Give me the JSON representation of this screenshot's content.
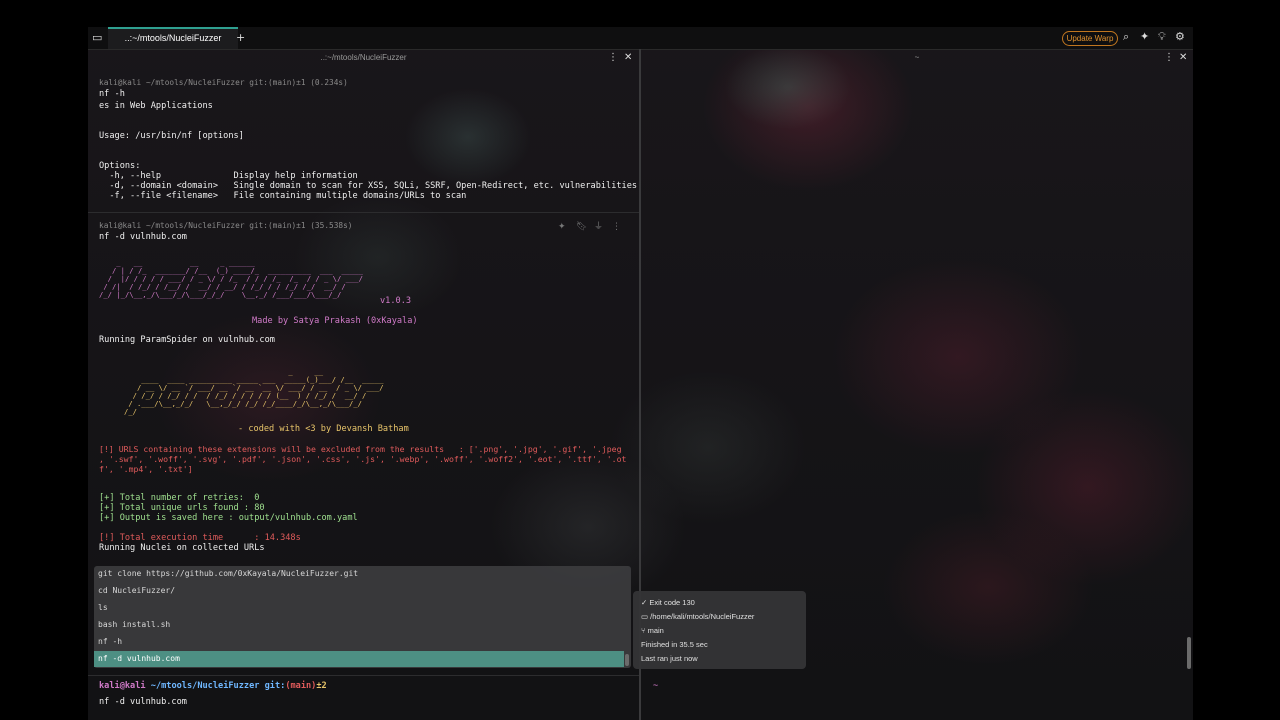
{
  "tabbar": {
    "tab_title": "..:~/mtools/NucleiFuzzer",
    "add_tab": "+",
    "update_button": "Update Warp"
  },
  "panes": {
    "left_title": "..:~/mtools/NucleiFuzzer",
    "right_title": "~"
  },
  "block1": {
    "prompt": "kali@kali ~/mtools/NucleiFuzzer git:(main)±1 (0.234s)",
    "command": "nf -h",
    "lines": [
      "es in Web Applications",
      "",
      "",
      "Usage: /usr/bin/nf [options]",
      "",
      "",
      "Options:",
      "  -h, --help              Display help information",
      "  -d, --domain <domain>   Single domain to scan for XSS, SQLi, SSRF, Open-Redirect, etc. vulnerabilities",
      "  -f, --file <filename>   File containing multiple domains/URLs to scan"
    ]
  },
  "block2": {
    "prompt": "kali@kali ~/mtools/NucleiFuzzer git:(main)±1 (35.538s)",
    "command": "nf -d vulnhub.com",
    "ascii_nf": "    _   __           __     _ ______                         \n   / | / /_  _______/ /__  (_) ____/_  __________  ___  _____\n  /  |/ / / / / ___/ / _ \\/ / /_  / / / /_  /_  / / _ \\/ ___/\n / /|  / /_/ / /__/ /  __/ / __/ / /_/ / / /_/ /_/  __/ /    \n/_/ |_/\\__,_/\\___/_/\\___/_/_/    \\__,_/ /___/___/\\___/_/     ",
    "version": "v1.0.3",
    "made_by": "Made by Satya Prakash (0xKayala)",
    "running_paramspider": "Running ParamSpider on vulnhub.com",
    "ascii_ps": "                                      _     __         \n    ____  ____ __________ _____ ___  _____(_)___/ /__  _____\n   / __ \\/ __ `/ ___/ __ `/ __ `__ \\/ ___/ / __  / _ \\/ ___/\n  / /_/ / /_/ / /  / /_/ / / / / / (__  ) / /_/ /  __/ /    \n / .___/\\__,_/_/   \\__,_/_/ /_/ /_/____/_/\\__,_/\\___/_/     \n/_/                                                          ",
    "coded_with": "- coded with <3 by Devansh Batham",
    "excluded_lines": [
      "[!] URLS containing these extensions will be excluded from the results   : ['.png', '.jpg', '.gif', '.jpeg",
      ", '.swf', '.woff', '.svg', '.pdf', '.json', '.css', '.js', '.webp', '.woff', '.woff2', '.eot', '.ttf', '.ot",
      "f', '.mp4', '.txt']"
    ],
    "stats": [
      "[+] Total number of retries:  0",
      "[+] Total unique urls found : 80",
      "[+] Output is saved here : output/vulnhub.com.yaml"
    ],
    "exec_time": "[!] Total execution time      : 14.348s",
    "running_nuclei": "Running Nuclei on collected URLs"
  },
  "history": [
    "git clone https://github.com/0xKayala/NucleiFuzzer.git",
    "cd NucleiFuzzer/",
    "ls",
    "bash install.sh",
    "nf -h",
    "nf -d vulnhub.com"
  ],
  "tooltip": {
    "exit_code": "Exit code 130",
    "path": "/home/kali/mtools/NucleiFuzzer",
    "branch": "main",
    "finished": "Finished in 35.5 sec",
    "last_ran": "Last ran just now"
  },
  "input": {
    "user_host": "kali@kali",
    "path": "~/mtools/NucleiFuzzer",
    "git_label": "git:",
    "git_branch": "(main)",
    "git_status": "±2",
    "typed": "nf -d vulnhub.com"
  },
  "right_prompt": "~"
}
